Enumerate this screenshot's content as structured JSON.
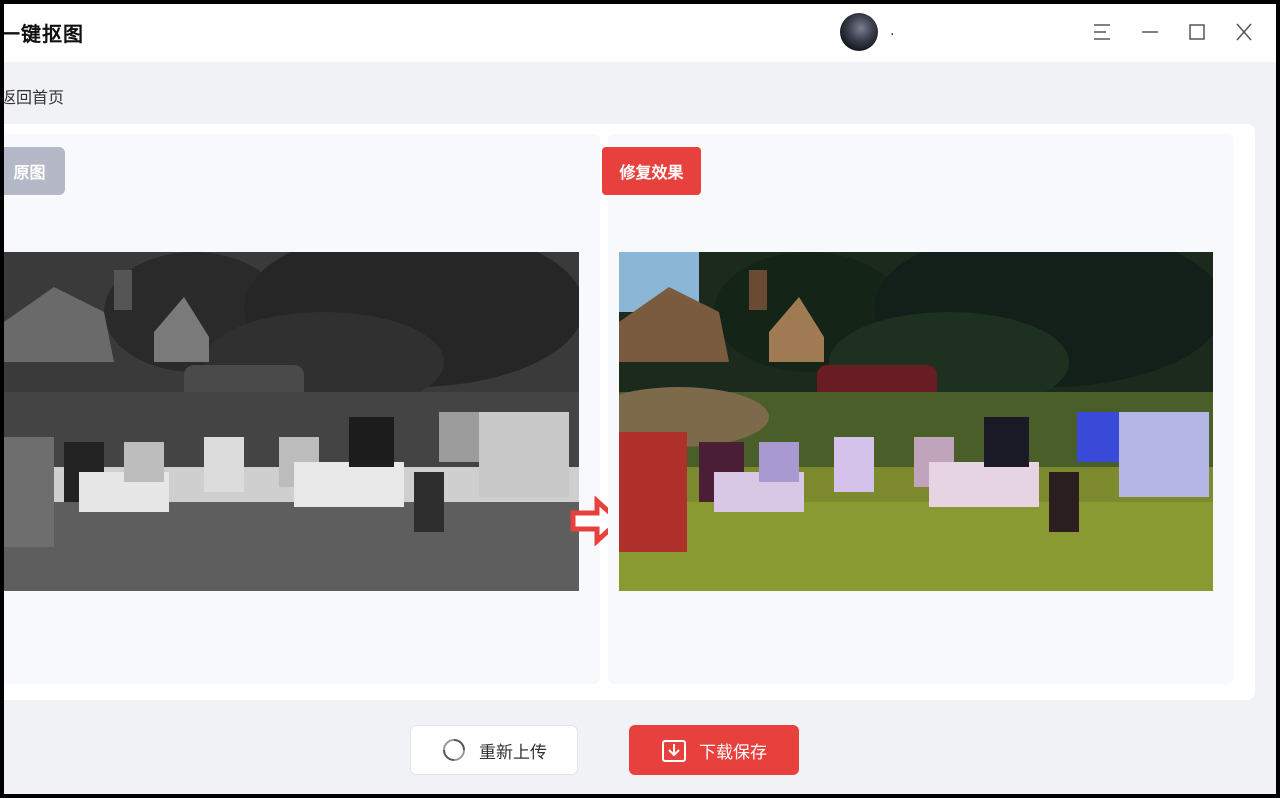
{
  "app": {
    "title": "一键抠图"
  },
  "header": {
    "user_name": "."
  },
  "nav": {
    "back_label": "返回首页"
  },
  "panels": {
    "original_tag": "原图",
    "result_tag": "修复效果"
  },
  "actions": {
    "reupload_label": "重新上传",
    "download_label": "下载保存"
  },
  "colors": {
    "accent": "#e8413d",
    "original_tag": "#b5b9c7",
    "background": "#f0f2f6"
  },
  "icons": {
    "menu": "menu-icon",
    "minimize": "minimize-icon",
    "maximize": "maximize-icon",
    "close": "close-icon",
    "arrow": "arrow-right-icon",
    "refresh": "refresh-icon",
    "download": "download-icon"
  }
}
